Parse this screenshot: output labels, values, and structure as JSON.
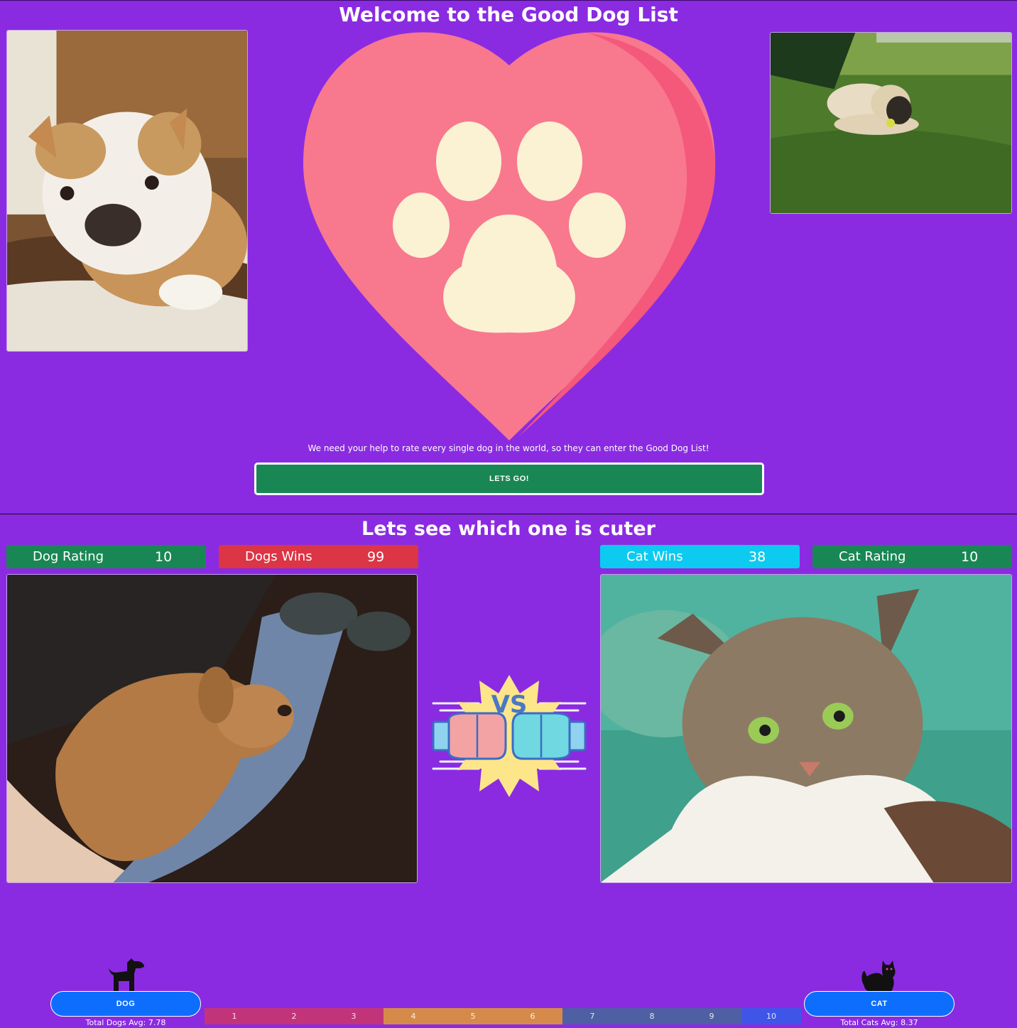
{
  "hero": {
    "title": "Welcome to the Good Dog List",
    "description": "We need your help to rate every single dog in the world, so they can enter the Good Dog List!",
    "cta_label": "LETS GO!"
  },
  "versus": {
    "title": "Lets see which one is cuter",
    "dog_rating": {
      "label": "Dog Rating",
      "value": "10"
    },
    "dog_wins": {
      "label": "Dogs Wins",
      "value": "99"
    },
    "cat_wins": {
      "label": "Cat Wins",
      "value": "38"
    },
    "cat_rating": {
      "label": "Cat Rating",
      "value": "10"
    },
    "vs_text": "VS"
  },
  "controls": {
    "dog_button": "DOG",
    "cat_button": "CAT",
    "dog_avg": "Total Dogs Avg: 7.78",
    "cat_avg": "Total Cats Avg: 8.37",
    "rating_scale": [
      "1",
      "2",
      "3",
      "4",
      "5",
      "6",
      "7",
      "8",
      "9",
      "10"
    ]
  },
  "icons": {
    "heart_logo": "heart-paw-icon",
    "versus": "boxing-gloves-vs-icon",
    "dog": "dog-silhouette-icon",
    "cat": "cat-silhouette-icon"
  },
  "colors": {
    "background": "#8a2be2",
    "success": "#198754",
    "danger": "#dc3545",
    "info": "#0dcaf0",
    "primary": "#0d6efd"
  }
}
